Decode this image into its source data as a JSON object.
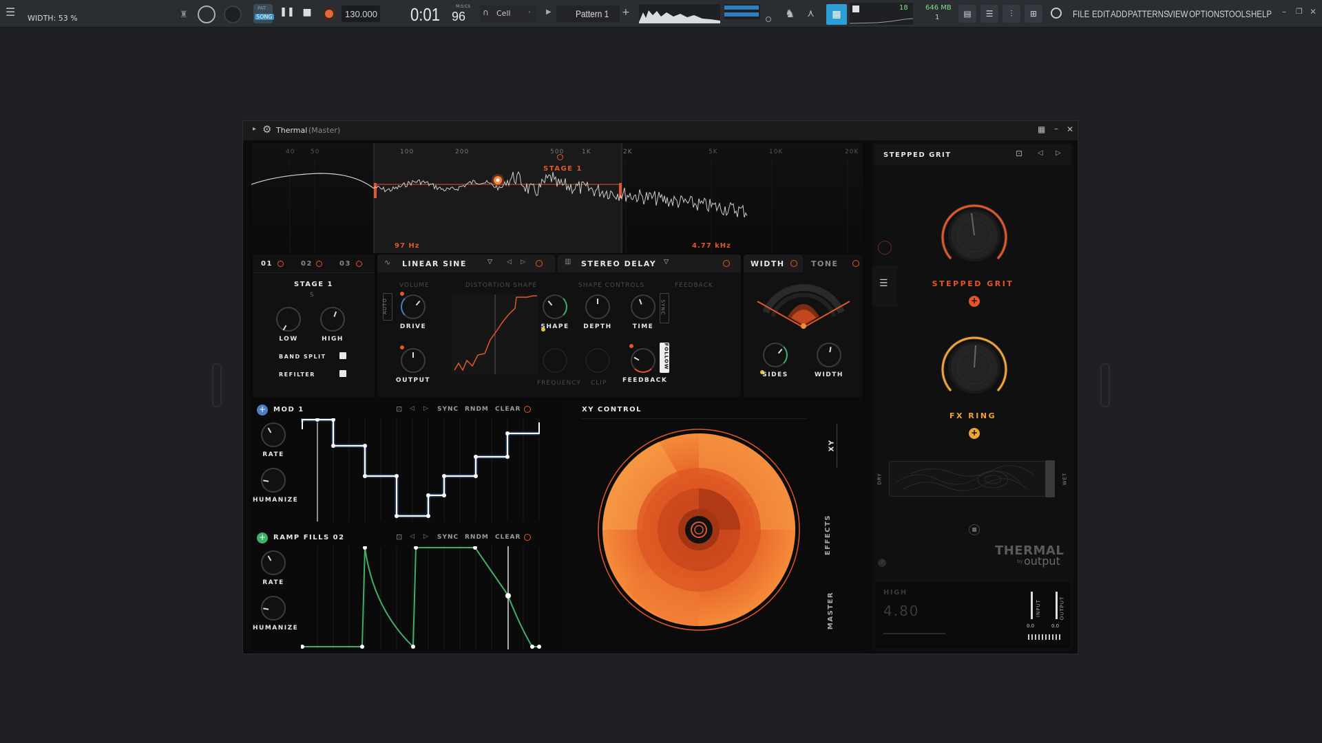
{
  "topbar": {
    "hint": "WIDTH: 53 %",
    "pat_label": "PAT",
    "song_label": "SONG",
    "tempo": "130.000",
    "time_main": "0:01",
    "time_sub": "96",
    "time_unit": "M:S:CS",
    "cell_label": "Cell",
    "pattern": "Pattern 1",
    "cpu": "18",
    "mem": "646 MB",
    "mem_sub": "1",
    "menu": [
      "FILE",
      "EDIT",
      "ADD",
      "PATTERNS",
      "VIEW",
      "OPTIONS",
      "TOOLS",
      "HELP"
    ]
  },
  "window": {
    "title": "Thermal",
    "subtitle": "(Master)"
  },
  "spectrum": {
    "freq_labels": [
      "40",
      "50",
      "100",
      "200",
      "500",
      "1K",
      "2K",
      "5K",
      "10K",
      "20K"
    ],
    "stage_label": "STAGE 1",
    "low_freq": "97 Hz",
    "high_freq": "4.77 kHz"
  },
  "stage": {
    "tabs": [
      "01",
      "02",
      "03"
    ],
    "title": "STAGE 1",
    "solo": "S",
    "low": "LOW",
    "high": "HIGH",
    "band_split": "BAND SPLIT",
    "refilter": "REFILTER"
  },
  "distortion": {
    "name": "LINEAR SINE",
    "volume": "VOLUME",
    "shape_title": "DISTORTION SHAPE",
    "auto": "AUTO",
    "drive": "DRIVE",
    "output": "OUTPUT"
  },
  "delay": {
    "name": "STEREO DELAY",
    "shape_controls": "SHAPE CONTROLS",
    "feedback_title": "FEEDBACK",
    "shape": "SHAPE",
    "depth": "DEPTH",
    "time": "TIME",
    "sync": "SYNC",
    "frequency": "FREQUENCY",
    "clip": "CLIP",
    "feedback": "FEEDBACK",
    "follow": "FOLLOW"
  },
  "width_panel": {
    "tab_width": "WIDTH",
    "tab_tone": "TONE",
    "sides": "SIDES",
    "width": "WIDTH"
  },
  "mod1": {
    "name": "MOD 1",
    "sync": "SYNC",
    "rndm": "RNDM",
    "clear": "CLEAR",
    "rate": "RATE",
    "humanize": "HUMANIZE"
  },
  "mod2": {
    "name": "RAMP FILLS 02",
    "sync": "SYNC",
    "rndm": "RNDM",
    "clear": "CLEAR",
    "rate": "RATE",
    "humanize": "HUMANIZE"
  },
  "xy": {
    "title": "XY CONTROL",
    "side_tabs": [
      "XY",
      "EFFECTS",
      "MASTER"
    ]
  },
  "right": {
    "preset": "STEPPED GRIT",
    "macro1": "STEPPED GRIT",
    "macro2": "FX RING",
    "dry": "DRY",
    "wet": "WET",
    "brand": "THERMAL",
    "by": "by",
    "maker": "output",
    "param_name": "HIGH",
    "param_value": "4.80",
    "input": "INPUT",
    "output": "OUTPUT",
    "input_val": "0.0",
    "output_val": "0.0"
  },
  "colors": {
    "accent": "#e2562a",
    "orange": "#f08a3c",
    "green": "#3fb06a",
    "blue": "#4a7fc4"
  }
}
